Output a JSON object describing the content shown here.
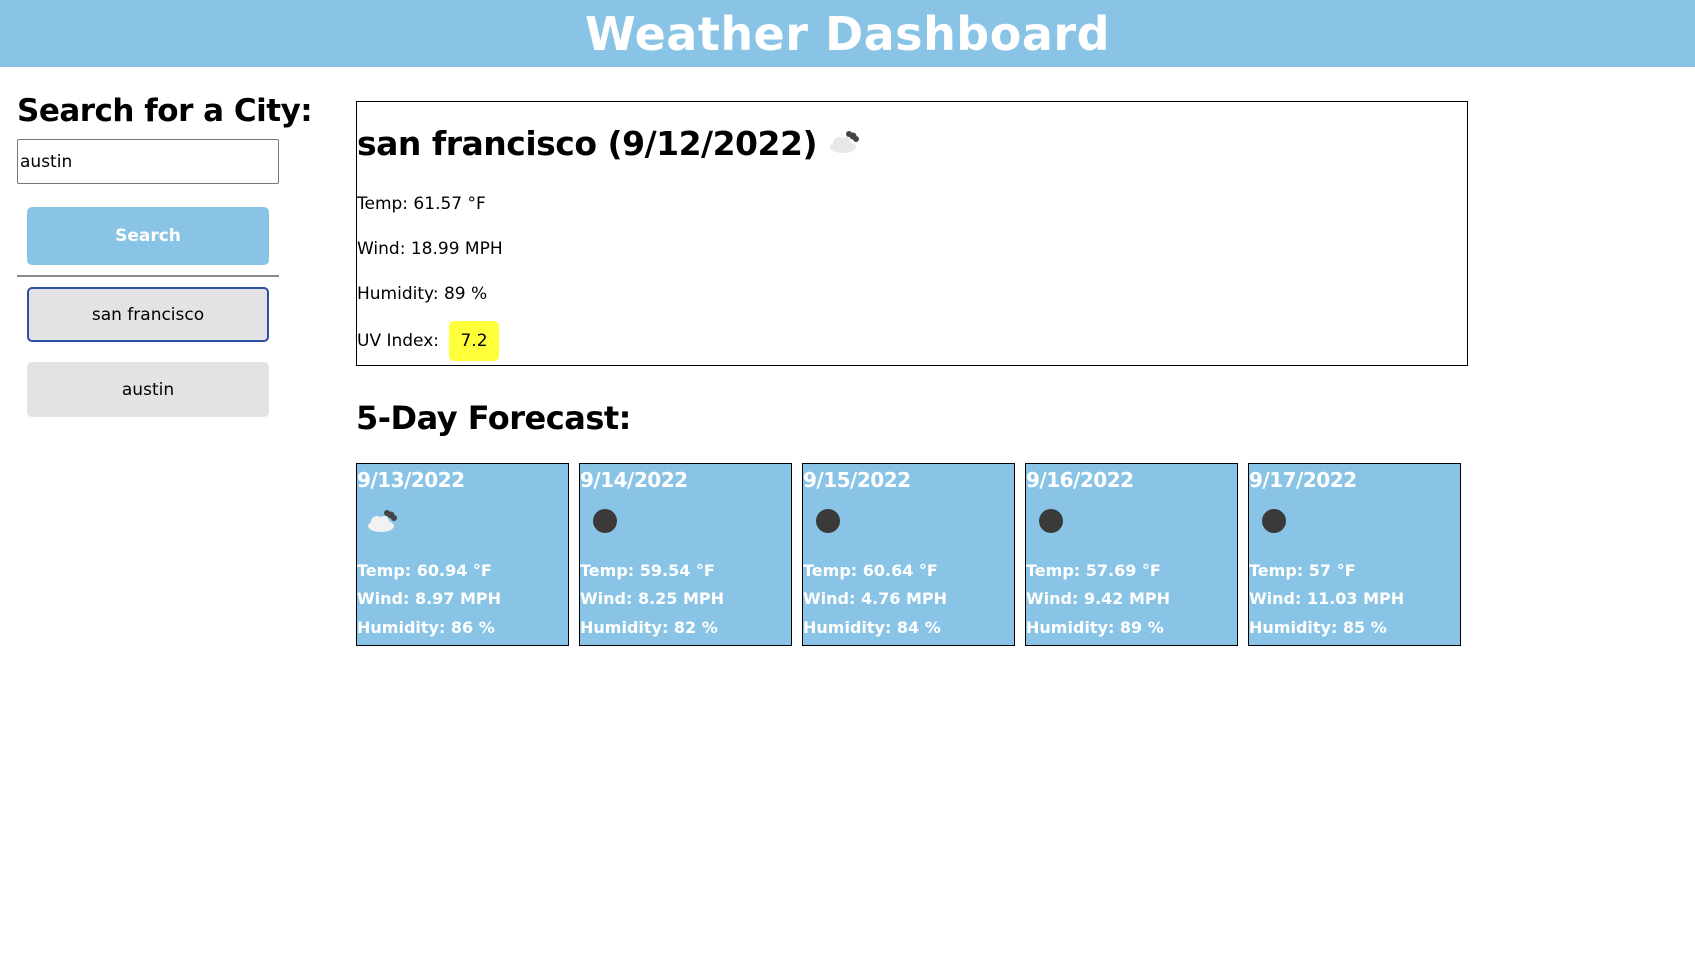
{
  "header": {
    "title": "Weather Dashboard"
  },
  "sidebar": {
    "heading": "Search for a City:",
    "search_value": "austin",
    "search_button": "Search",
    "history": [
      "san francisco",
      "austin"
    ]
  },
  "current": {
    "title": "san francisco (9/12/2022)",
    "icon": "cloud-night-icon",
    "temp": "Temp: 61.57 °F",
    "wind": "Wind: 18.99 MPH",
    "humidity": "Humidity: 89 %",
    "uv_label": "UV Index:",
    "uv_value": "7.2",
    "uv_color": "#ffff3a"
  },
  "forecast": {
    "heading": "5-Day Forecast:",
    "days": [
      {
        "date": "9/13/2022",
        "icon": "cloud-night-icon",
        "temp": "Temp: 60.94 °F",
        "wind": "Wind: 8.97 MPH",
        "humidity": "Humidity: 86 %"
      },
      {
        "date": "9/14/2022",
        "icon": "moon-icon",
        "temp": "Temp: 59.54 °F",
        "wind": "Wind: 8.25 MPH",
        "humidity": "Humidity: 82 %"
      },
      {
        "date": "9/15/2022",
        "icon": "moon-icon",
        "temp": "Temp: 60.64 °F",
        "wind": "Wind: 4.76 MPH",
        "humidity": "Humidity: 84 %"
      },
      {
        "date": "9/16/2022",
        "icon": "moon-icon",
        "temp": "Temp: 57.69 °F",
        "wind": "Wind: 9.42 MPH",
        "humidity": "Humidity: 89 %"
      },
      {
        "date": "9/17/2022",
        "icon": "moon-icon",
        "temp": "Temp: 57 °F",
        "wind": "Wind: 11.03 MPH",
        "humidity": "Humidity: 85 %"
      }
    ]
  },
  "colors": {
    "brand": "#89c4e6",
    "active_border": "#2d4fa8",
    "history_bg": "#e3e3e3"
  }
}
